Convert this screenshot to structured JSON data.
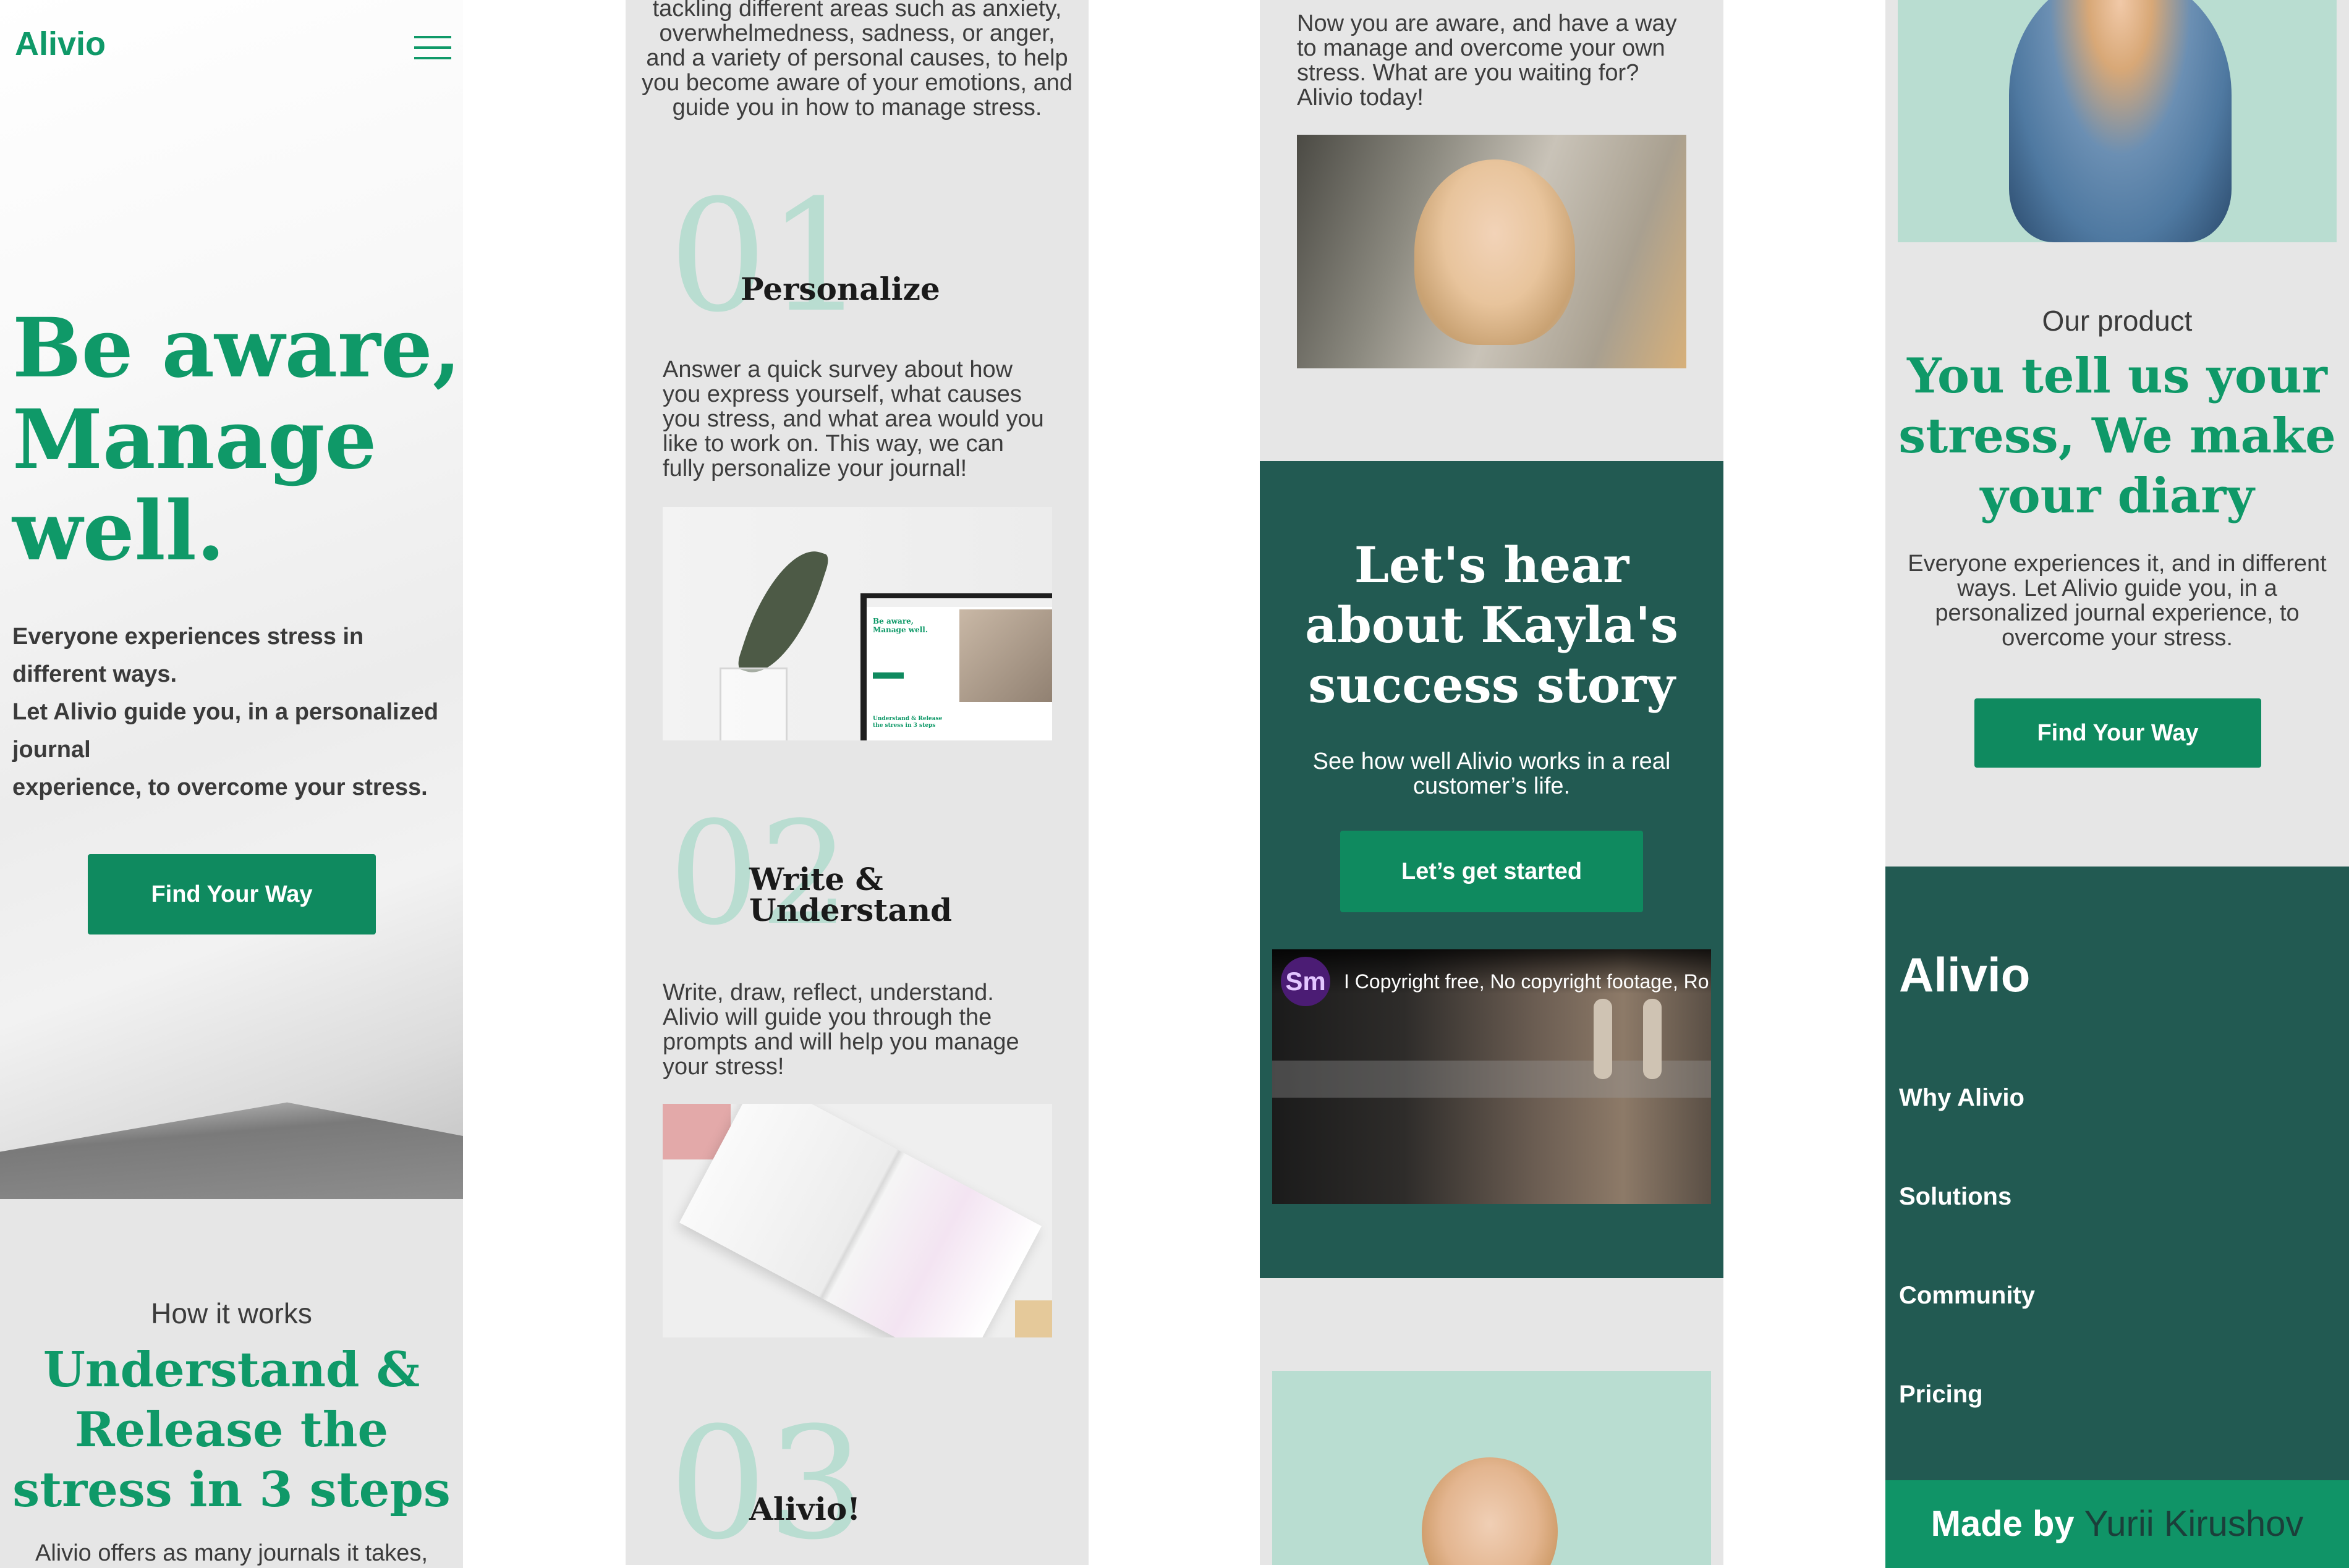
{
  "brand": {
    "name": "Alivio",
    "accent": "#0f9968",
    "dark": "#225a52",
    "mint": "#b9ddd1"
  },
  "header": {
    "logo": "Alivio",
    "menu_icon": "hamburger-icon"
  },
  "hero": {
    "title_lines": [
      "Be aware,",
      "Manage",
      "well."
    ],
    "text_lines": [
      "Everyone experiences stress in",
      "different ways.",
      "Let Alivio guide you, in a personalized",
      "journal",
      "experience, to overcome your stress."
    ],
    "cta": "Find Your Way"
  },
  "how": {
    "eyebrow": "How it works",
    "title_lines": [
      "Understand &",
      "Release the",
      "stress in 3 steps"
    ],
    "intro_partial": "Alivio offers as many journals it takes,",
    "intro_cont_lines": [
      "tackling different areas such as anxiety,",
      "overwhelmedness, sadness, or anger,",
      "and a variety of personal causes, to help",
      "you become aware of your emotions, and",
      "guide you in how to manage stress."
    ]
  },
  "steps": [
    {
      "num": "01",
      "title": "Personalize",
      "text_lines": [
        "Answer a quick survey about how",
        "you express yourself, what causes",
        "you stress, and what area would you",
        "like to work on. This way, we can",
        "fully personalize your journal!"
      ]
    },
    {
      "num": "02",
      "title_lines": [
        "Write &",
        "Understand"
      ],
      "text_lines": [
        "Write, draw, reflect, understand.",
        "Alivio will guide you through the",
        "prompts and will help you manage",
        "your stress!"
      ]
    },
    {
      "num": "03",
      "title": "Alivio!"
    }
  ],
  "laptop_mock": {
    "title_lines": [
      "Be aware,",
      "Manage well."
    ],
    "subtitle_lines": [
      "Understand & Release",
      "the stress in 3 steps"
    ]
  },
  "step3_text_lines": [
    "Now you are aware, and have a way",
    "to manage and overcome your own",
    "stress. What are you waiting for?",
    "Alivio today!"
  ],
  "story": {
    "title_lines": [
      "Let's hear",
      "about Kayla's",
      "success story"
    ],
    "text_lines": [
      "See how well Alivio works in a real",
      "customer’s life."
    ],
    "cta": "Let’s get started",
    "video": {
      "channel_badge": "Sm",
      "title": "I Copyright free, No copyright footage, Ro"
    }
  },
  "product": {
    "eyebrow": "Our product",
    "title_lines": [
      "You tell us your",
      "stress, We make",
      "your diary"
    ],
    "text_lines": [
      "Everyone experiences it, and in different",
      "ways. Let Alivio guide you, in a",
      "personalized journal experience, to",
      "overcome your stress."
    ],
    "cta": "Find Your Way"
  },
  "footer": {
    "logo": "Alivio",
    "links": [
      "Why Alivio",
      "Solutions",
      "Community",
      "Pricing"
    ],
    "made_by": "Made by",
    "author": "Yurii Kirushov"
  }
}
